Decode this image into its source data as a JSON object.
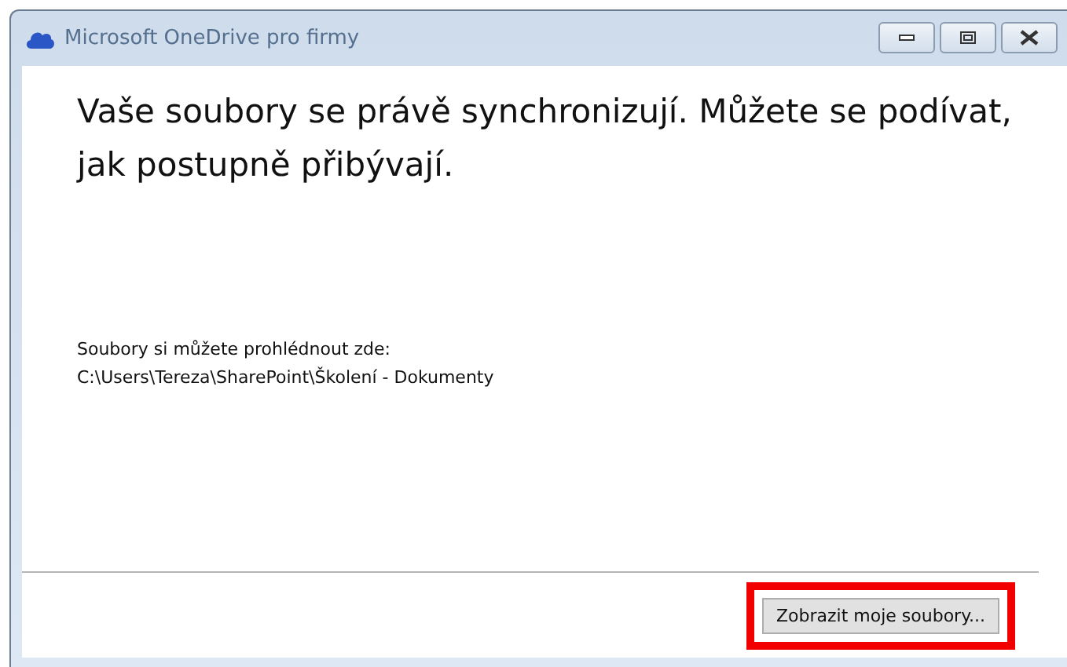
{
  "window": {
    "title": "Microsoft OneDrive pro firmy"
  },
  "heading": "Vaše soubory se právě synchronizují. Můžete se podívat, jak postupně přibývají.",
  "location": {
    "label": "Soubory si můžete prohlédnout zde:",
    "path": "C:\\Users\\Tereza\\SharePoint\\Školení - Dokumenty"
  },
  "button": {
    "label": "Zobrazit moje soubory...",
    "highlighted": true
  }
}
